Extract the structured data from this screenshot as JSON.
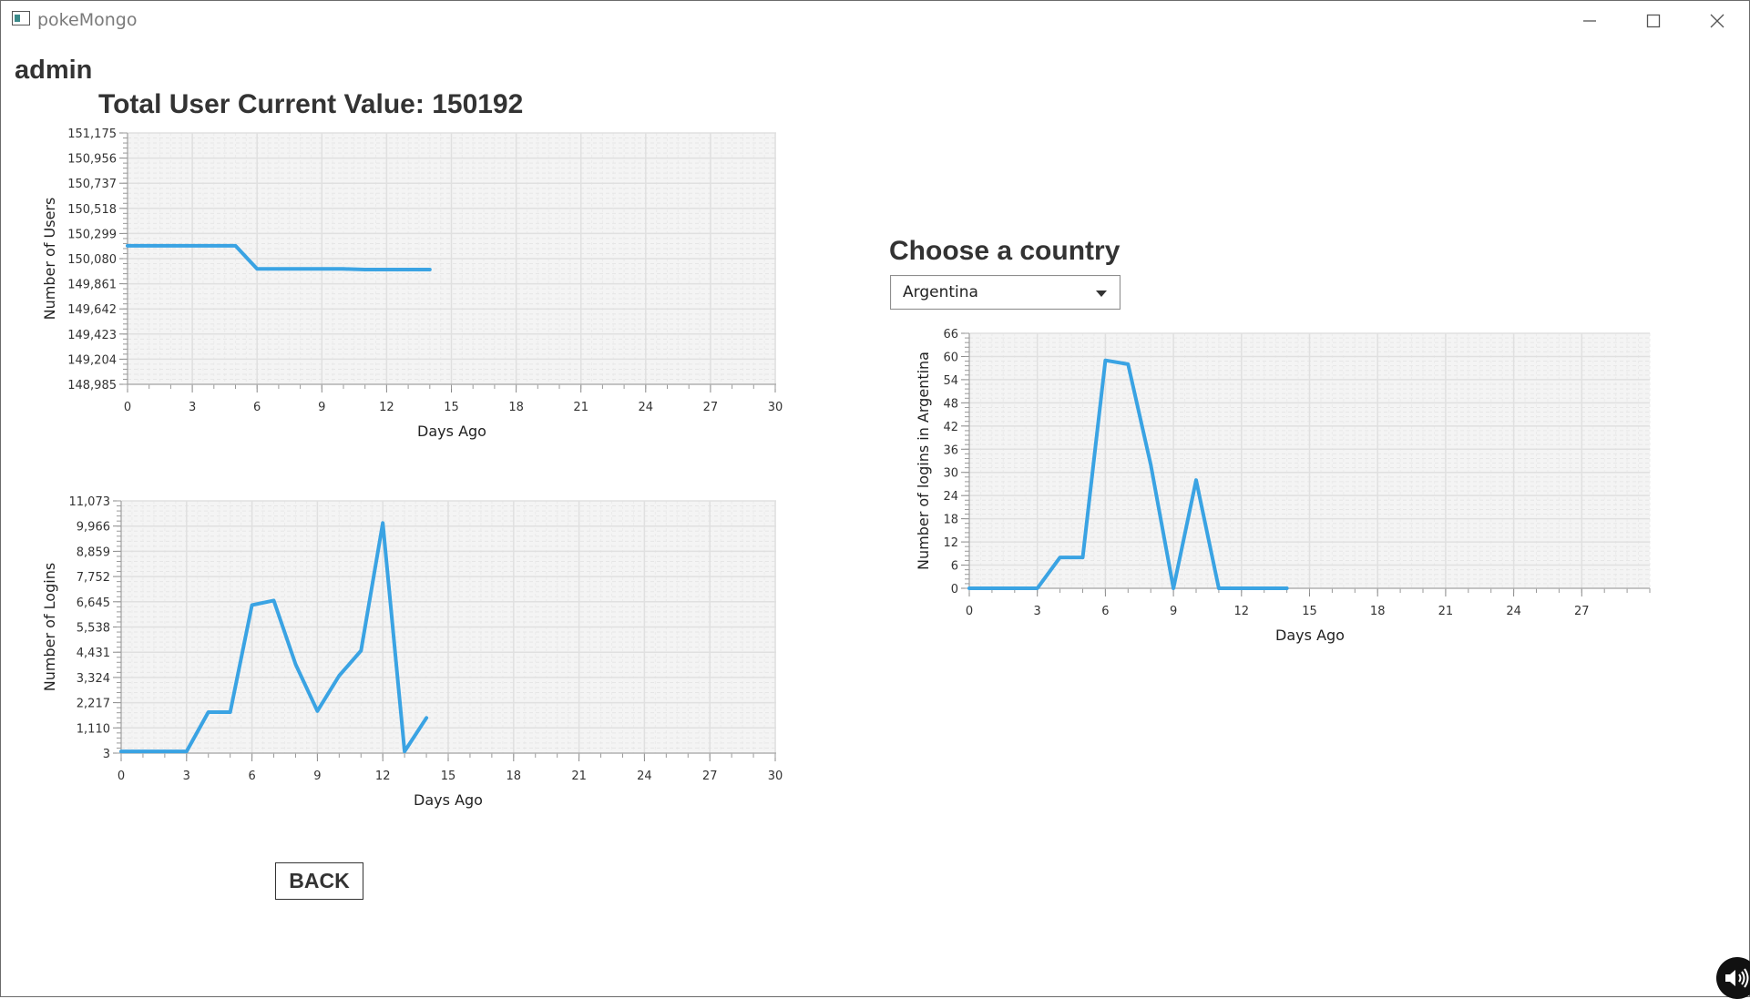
{
  "window": {
    "title": "pokeMongo"
  },
  "icons": {
    "app": "app-window-icon",
    "minimize": "minimize-icon",
    "maximize": "maximize-icon",
    "close": "close-icon",
    "dropdown": "chevron-down-icon",
    "speaker": "speaker-icon"
  },
  "header": {
    "username": "admin",
    "total_label": "Total User Current Value: 150192"
  },
  "country": {
    "heading": "Choose a country",
    "selected": "Argentina"
  },
  "buttons": {
    "back": "BACK"
  },
  "colors": {
    "series": "#3aa3e3",
    "plot_bg": "#f4f4f4",
    "grid": "#e0e0e0"
  },
  "chart_data": [
    {
      "id": "users",
      "type": "line",
      "xlabel": "Days Ago",
      "ylabel": "Number of Users",
      "xlim": [
        0,
        30
      ],
      "ylim": [
        148985,
        151175
      ],
      "x_ticks": [
        "0",
        "3",
        "6",
        "9",
        "12",
        "15",
        "18",
        "21",
        "24",
        "27",
        "30"
      ],
      "y_ticks": [
        "148,985",
        "149,204",
        "149,423",
        "149,642",
        "149,861",
        "150,080",
        "150,299",
        "150,518",
        "150,737",
        "150,956",
        "151,175"
      ],
      "grid": true,
      "x": [
        0,
        1,
        2,
        3,
        4,
        5,
        6,
        7,
        8,
        9,
        10,
        11,
        12,
        13,
        14
      ],
      "y": [
        150192,
        150192,
        150192,
        150192,
        150192,
        150192,
        149990,
        149990,
        149990,
        149990,
        149990,
        149985,
        149985,
        149985,
        149985
      ]
    },
    {
      "id": "logins",
      "type": "line",
      "xlabel": "Days Ago",
      "ylabel": "Number of Logins",
      "xlim": [
        0,
        30
      ],
      "ylim": [
        3,
        11073
      ],
      "x_ticks": [
        "0",
        "3",
        "6",
        "9",
        "12",
        "15",
        "18",
        "21",
        "24",
        "27",
        "30"
      ],
      "y_ticks": [
        "3",
        "1,110",
        "2,217",
        "3,324",
        "4,431",
        "5,538",
        "6,645",
        "7,752",
        "8,859",
        "9,966",
        "11,073"
      ],
      "grid": true,
      "x": [
        0,
        1,
        2,
        3,
        4,
        5,
        6,
        7,
        8,
        9,
        10,
        11,
        12,
        13,
        14
      ],
      "y": [
        80,
        80,
        80,
        80,
        1800,
        1800,
        6500,
        6700,
        3900,
        1850,
        3400,
        4500,
        10100,
        80,
        1550
      ]
    },
    {
      "id": "country",
      "type": "line",
      "xlabel": "Days Ago",
      "ylabel": "Number of logins in Argentina",
      "xlim": [
        0,
        30
      ],
      "ylim": [
        0,
        66
      ],
      "x_ticks": [
        "0",
        "3",
        "6",
        "9",
        "12",
        "15",
        "18",
        "21",
        "24",
        "27"
      ],
      "y_ticks": [
        "0",
        "6",
        "12",
        "18",
        "24",
        "30",
        "36",
        "42",
        "48",
        "54",
        "60",
        "66"
      ],
      "grid": true,
      "x": [
        0,
        1,
        2,
        3,
        4,
        5,
        6,
        7,
        8,
        9,
        10,
        11,
        12,
        13,
        14
      ],
      "y": [
        0,
        0,
        0,
        0,
        8,
        8,
        59,
        58,
        32,
        0,
        28,
        0,
        0,
        0,
        0
      ]
    }
  ]
}
